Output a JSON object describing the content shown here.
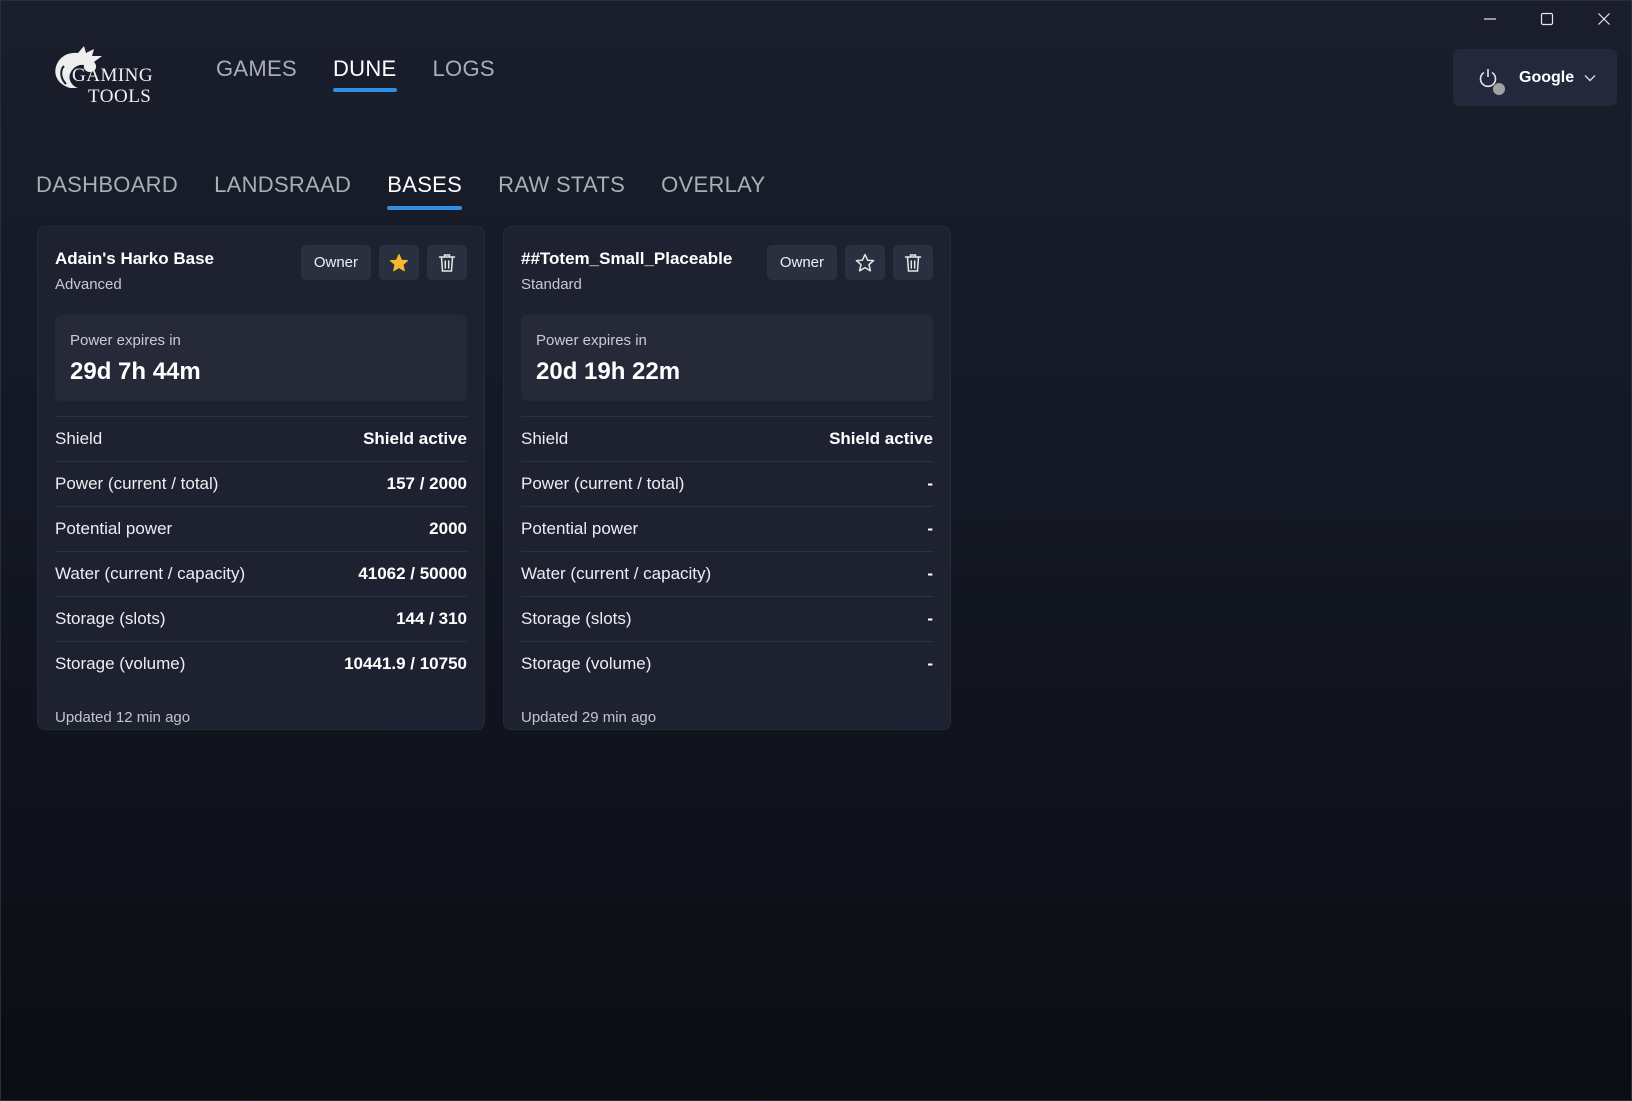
{
  "app": {
    "logo_line1": "GAMING",
    "logo_line2": "TOOLS"
  },
  "top_nav": [
    {
      "label": "GAMES",
      "active": false
    },
    {
      "label": "DUNE",
      "active": true
    },
    {
      "label": "LOGS",
      "active": false
    }
  ],
  "account": {
    "name": "Google",
    "power_icon": "power-icon",
    "status_color": "#a2a2a2"
  },
  "sub_nav": [
    {
      "label": "DASHBOARD",
      "active": false
    },
    {
      "label": "LANDSRAAD",
      "active": false
    },
    {
      "label": "BASES",
      "active": true
    },
    {
      "label": "RAW STATS",
      "active": false
    },
    {
      "label": "OVERLAY",
      "active": false
    }
  ],
  "colors": {
    "accent": "#2f8fe8",
    "star_active": "#f5b82e"
  },
  "bases": [
    {
      "name": "Adain's Harko Base",
      "tier": "Advanced",
      "role": "Owner",
      "favorite": true,
      "power_expires_label": "Power expires in",
      "power_expires_value": "29d 7h 44m",
      "stats": [
        {
          "label": "Shield",
          "value": "Shield active"
        },
        {
          "label": "Power (current / total)",
          "value": "157 / 2000"
        },
        {
          "label": "Potential power",
          "value": "2000"
        },
        {
          "label": "Water (current / capacity)",
          "value": "41062 / 50000"
        },
        {
          "label": "Storage (slots)",
          "value": "144 / 310"
        },
        {
          "label": "Storage (volume)",
          "value": "10441.9 / 10750"
        }
      ],
      "updated": "Updated 12 min ago"
    },
    {
      "name": "##Totem_Small_Placeable",
      "tier": "Standard",
      "role": "Owner",
      "favorite": false,
      "power_expires_label": "Power expires in",
      "power_expires_value": "20d 19h 22m",
      "stats": [
        {
          "label": "Shield",
          "value": "Shield active"
        },
        {
          "label": "Power (current / total)",
          "value": "-"
        },
        {
          "label": "Potential power",
          "value": "-"
        },
        {
          "label": "Water (current / capacity)",
          "value": "-"
        },
        {
          "label": "Storage (slots)",
          "value": "-"
        },
        {
          "label": "Storage (volume)",
          "value": "-"
        }
      ],
      "updated": "Updated 29 min ago"
    }
  ]
}
